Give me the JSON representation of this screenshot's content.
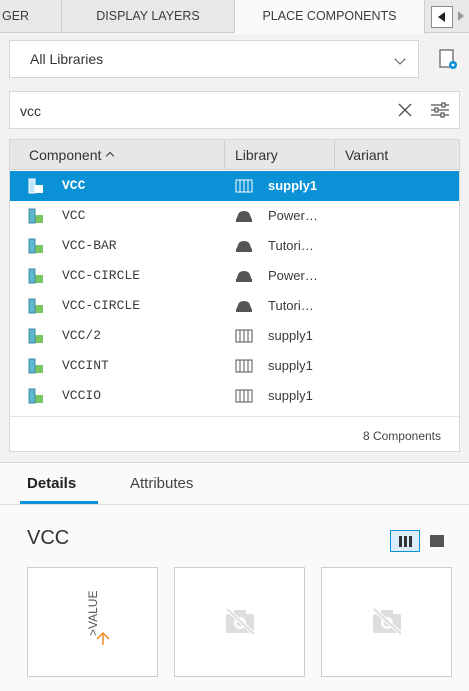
{
  "tabs": [
    {
      "label": "GER"
    },
    {
      "label": "DISPLAY LAYERS"
    },
    {
      "label": "PLACE COMPONENTS"
    }
  ],
  "library_select": {
    "value": "All Libraries"
  },
  "search": {
    "value": "vcc",
    "placeholder": ""
  },
  "table": {
    "headers": {
      "component": "Component",
      "library": "Library",
      "variant": "Variant"
    },
    "rows": [
      {
        "component": "VCC",
        "library": "supply1",
        "lib_icon": "library-icon",
        "selected": true
      },
      {
        "component": "VCC",
        "library": "Power…",
        "lib_icon": "cloud-library-icon"
      },
      {
        "component": "VCC-BAR",
        "library": "Tutori…",
        "lib_icon": "cloud-library-icon"
      },
      {
        "component": "VCC-CIRCLE",
        "library": "Power…",
        "lib_icon": "cloud-library-icon"
      },
      {
        "component": "VCC-CIRCLE",
        "library": "Tutori…",
        "lib_icon": "cloud-library-icon"
      },
      {
        "component": "VCC/2",
        "library": "supply1",
        "lib_icon": "library-icon"
      },
      {
        "component": "VCCINT",
        "library": "supply1",
        "lib_icon": "library-icon"
      },
      {
        "component": "VCCIO",
        "library": "supply1",
        "lib_icon": "library-icon"
      }
    ],
    "count": "8 Components"
  },
  "details": {
    "tabs": {
      "details": "Details",
      "attributes": "Attributes"
    },
    "name": "VCC",
    "symbol_label": ">VALUE"
  },
  "colors": {
    "accent": "#0b91d6",
    "symbol_orange": "#f08a24"
  }
}
